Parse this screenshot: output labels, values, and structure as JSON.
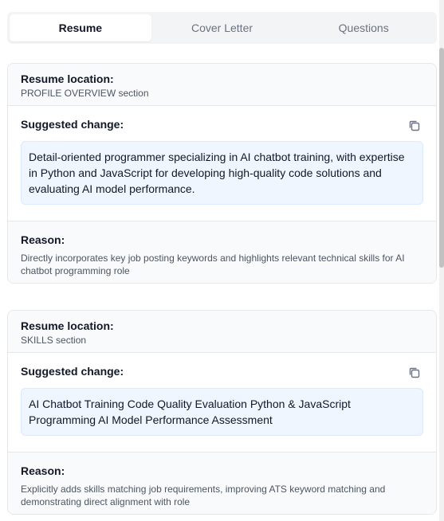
{
  "tabs": [
    {
      "label": "Resume",
      "active": true
    },
    {
      "label": "Cover Letter",
      "active": false
    },
    {
      "label": "Questions",
      "active": false
    }
  ],
  "labels": {
    "location": "Resume location:",
    "suggested": "Suggested change:",
    "reason": "Reason:"
  },
  "suggestions": [
    {
      "location": "PROFILE OVERVIEW section",
      "change": "Detail-oriented programmer specializing in AI chatbot training, with expertise in Python and JavaScript for developing high-quality code solutions and evaluating AI model performance.",
      "reason": "Directly incorporates key job posting keywords and highlights relevant technical skills for AI chatbot programming role"
    },
    {
      "location": "SKILLS section",
      "change": "AI Chatbot Training Code Quality Evaluation Python & JavaScript Programming AI Model Performance Assessment",
      "reason": "Explicitly adds skills matching job requirements, improving ATS keyword matching and demonstrating direct alignment with role"
    }
  ],
  "icons": {
    "copy": "copy-icon"
  },
  "colors": {
    "suggest_bg": "#eff6ff",
    "section_bg": "#f9fafb",
    "border": "#e5e7eb"
  }
}
